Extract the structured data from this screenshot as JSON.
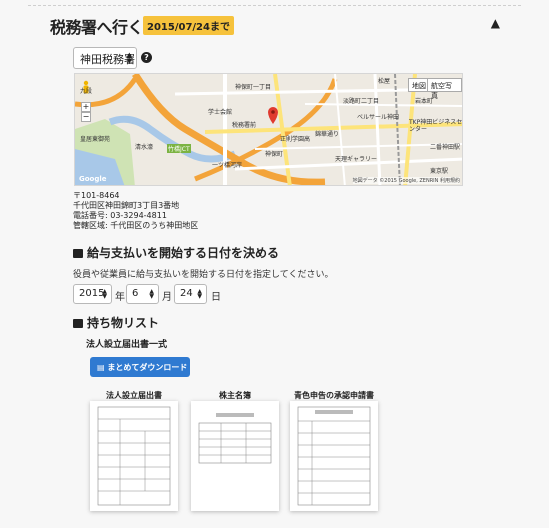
{
  "header": {
    "title": "税務署へ行く",
    "deadline": "2015/07/24まで",
    "collapse_icon": "chevron-up-icon"
  },
  "office_select": {
    "value": "神田税務署",
    "icon": "help-icon"
  },
  "map": {
    "buttons": [
      "地図",
      "航空写真"
    ],
    "labels": [
      "神保町一丁目",
      "学士会館",
      "税務署前",
      "正則学園高",
      "錦華通り",
      "淡路町二丁目",
      "九段",
      "一ツ橋河岸",
      "清水濠",
      "皇居東御苑",
      "竹橋JCT",
      "岩本町",
      "松屋",
      "ベルサール神田",
      "TKP神田ビジネスセンター",
      "天理ギャラリー",
      "神保町",
      "二番神田駅",
      "東京駅"
    ],
    "credit": "地図データ ©2015 Google, ZENRIN 利用規約",
    "logo": "Google"
  },
  "address": {
    "postal": "〒101-8464",
    "street": "千代田区神田錦町3丁目3番地",
    "phone": "電話番号: 03-3294-4811",
    "area": "管轄区域: 千代田区のうち神田地区"
  },
  "date_section": {
    "heading": "給与支払いを開始する日付を決める",
    "icon": "calendar-icon",
    "instruction": "役員や従業員に給与支払いを開始する日付を指定してください。",
    "year": "2015",
    "year_unit": "年",
    "month": "6",
    "month_unit": "月",
    "day": "24",
    "day_unit": "日"
  },
  "items_section": {
    "heading": "持ち物リスト",
    "icon": "briefcase-icon",
    "doc_set": "法人設立届出書一式",
    "download_label": "まとめてダウンロード",
    "download_icon": "print-icon",
    "documents": [
      {
        "title": "法人設立届出書"
      },
      {
        "title": "株主名簿"
      },
      {
        "title": "青色申告の承認申請書"
      }
    ]
  },
  "colors": {
    "deadline_bg": "#f6c23c",
    "button_bg": "#2f7ad1"
  }
}
